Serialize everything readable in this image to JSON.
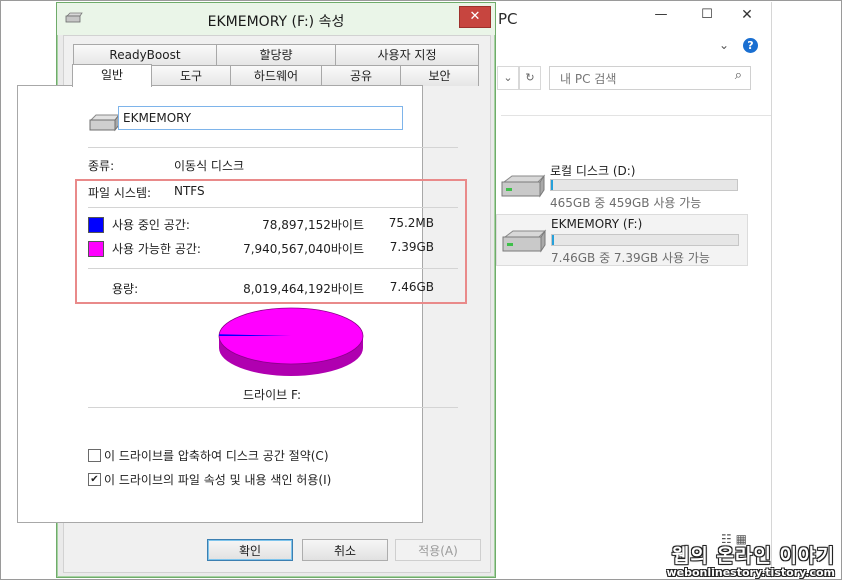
{
  "explorer": {
    "title": "PC",
    "controls": {
      "minimize": "—",
      "maximize": "☐",
      "close": "✕"
    },
    "chevron": "⌄",
    "help": "?",
    "nav_dropdown": "⌄",
    "refresh": "↻",
    "search_placeholder": "내 PC 검색",
    "search_icon": "⌕",
    "drives": [
      {
        "name": "로컬 디스크 (D:)",
        "free_text": "465GB 중 459GB 사용 가능",
        "used_fraction": 0.013,
        "icon": "hard-drive-icon"
      },
      {
        "name": "EKMEMORY (F:)",
        "free_text": "7.46GB 중 7.39GB 사용 가능",
        "used_fraction": 0.009,
        "icon": "usb-drive-icon",
        "selected": true
      }
    ],
    "view_icons": "☷ ▦"
  },
  "dialog": {
    "title": "EKMEMORY (F:) 속성",
    "close_label": "✕",
    "tabs_row1": [
      "ReadyBoost",
      "할당량",
      "사용자 지정"
    ],
    "tabs_row2": [
      "일반",
      "도구",
      "하드웨어",
      "공유",
      "보안"
    ],
    "active_tab": "일반",
    "drive_name_value": "EKMEMORY",
    "type_label": "종류:",
    "type_value": "이동식 디스크",
    "fs_label": "파일 시스템:",
    "fs_value": "NTFS",
    "used": {
      "label": "사용 중인 공간:",
      "bytes": "78,897,152바이트",
      "size": "75.2MB",
      "color": "#0000ff"
    },
    "free": {
      "label": "사용 가능한 공간:",
      "bytes": "7,940,567,040바이트",
      "size": "7.39GB",
      "color": "#ff00ff"
    },
    "capacity": {
      "label": "용량:",
      "bytes": "8,019,464,192바이트",
      "size": "7.46GB"
    },
    "used_fraction": 0.0098,
    "drive_label": "드라이브 F:",
    "compress_label": "이 드라이브를 압축하여 디스크 공간 절약(C)",
    "compress_checked": false,
    "index_label": "이 드라이브의 파일 속성 및 내용 색인 허용(I)",
    "index_checked": true,
    "check_mark": "✔",
    "buttons": {
      "ok": "확인",
      "cancel": "취소",
      "apply": "적용(A)"
    }
  },
  "watermark": {
    "title": "웹의 온라인 이야기",
    "url": "webonlinestory.tistory.com"
  }
}
